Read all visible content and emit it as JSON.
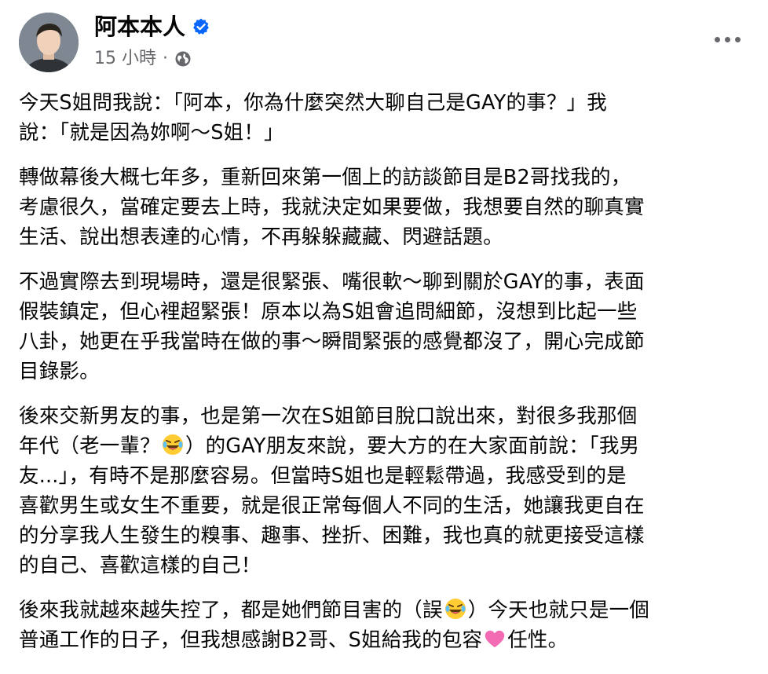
{
  "post": {
    "author": "阿本本人",
    "timestamp": "15 小時",
    "separator": "·",
    "visibility_icon": "globe-icon",
    "more_icon": "more-horizontal-icon"
  },
  "paragraphs": [
    {
      "lines": [
        "今天S姐問我說：「阿本，你為什麼突然大聊自己是GAY的事？」我",
        "說：「就是因為妳啊～S姐！」"
      ]
    },
    {
      "lines": [
        "轉做幕後大概七年多，重新回來第一個上的訪談節目是B2哥找我的，",
        "考慮很久，當確定要去上時，我就決定如果要做，我想要自然的聊真實",
        "生活、說出想表達的心情，不再躲躲藏藏、閃避話題。"
      ]
    },
    {
      "lines": [
        "不過實際去到現場時，還是很緊張、嘴很軟～聊到關於GAY的事，表面",
        "假裝鎮定，但心裡超緊張！原本以為S姐會追問細節，沒想到比起一些",
        "八卦，她更在乎我當時在做的事～瞬間緊張的感覺都沒了，開心完成節",
        "目錄影。"
      ]
    },
    {
      "line1": "後來交新男友的事，也是第一次在S姐節目脫口說出來，對很多我那個",
      "line2a": "年代（老一輩？",
      "line2b": "）的GAY朋友來說，要大方的在大家面前說：「我男",
      "rest": [
        "友...」，有時不是那麼容易。但當時S姐也是輕鬆帶過，我感受到的是",
        "喜歡男生或女生不重要，就是很正常每個人不同的生活，她讓我更自在",
        "的分享我人生發生的糗事、趣事、挫折、困難，我也真的就更接受這樣",
        "的自己、喜歡這樣的自己！"
      ]
    },
    {
      "line1a": "後來我就越來越失控了，都是她們節目害的（誤",
      "line1b": "）今天也就只是一個",
      "line2a": "普通工作的日子，但我想感謝B2哥、S姐給我的包容",
      "line2b": "任性。"
    }
  ],
  "emojis": {
    "laughing": "rolling-on-floor-laughing-emoji",
    "heart": "pink-heart-emoji"
  },
  "colors": {
    "text": "#050505",
    "secondary": "#65676b",
    "verified": "#0866ff",
    "heart": "#f26bb3",
    "emoji_yellow": "#ffcc33"
  }
}
